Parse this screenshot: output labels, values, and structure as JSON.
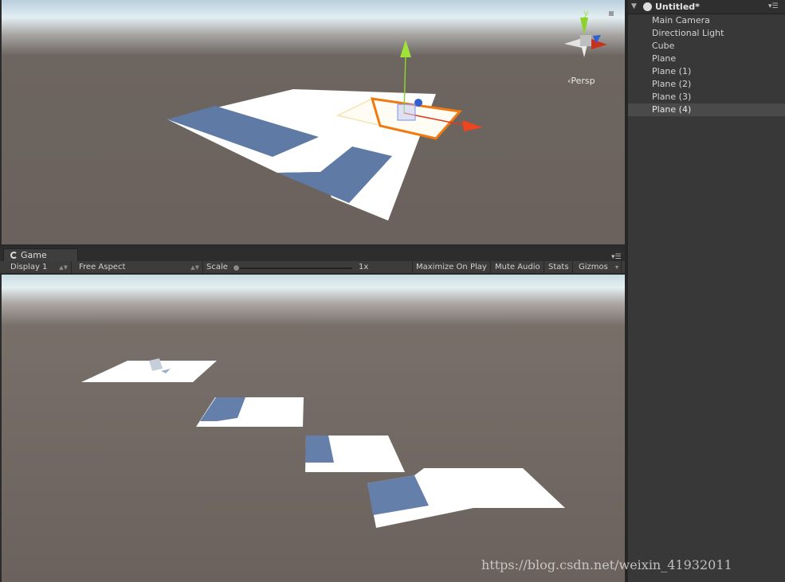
{
  "scene": {
    "persp_label": "Persp",
    "gizmo_y_label": "y",
    "colors": {
      "axis_y": "#8dd22a",
      "axis_x": "#e23a1e",
      "axis_z": "#2f5fd0",
      "selection": "#f07a10"
    }
  },
  "game": {
    "tab_label": "Game",
    "toolbar": {
      "display": "Display 1",
      "aspect": "Free Aspect",
      "scale_label": "Scale",
      "scale_value": "1x",
      "maximize": "Maximize On Play",
      "mute": "Mute Audio",
      "stats": "Stats",
      "gizmos": "Gizmos"
    }
  },
  "hierarchy": {
    "title": "Untitled*",
    "items": [
      {
        "label": "Main Camera",
        "selected": false
      },
      {
        "label": "Directional Light",
        "selected": false
      },
      {
        "label": "Cube",
        "selected": false
      },
      {
        "label": "Plane",
        "selected": false
      },
      {
        "label": "Plane (1)",
        "selected": false
      },
      {
        "label": "Plane (2)",
        "selected": false
      },
      {
        "label": "Plane (3)",
        "selected": false
      },
      {
        "label": "Plane (4)",
        "selected": true
      }
    ]
  },
  "watermark": "https://blog.csdn.net/weixin_41932011"
}
